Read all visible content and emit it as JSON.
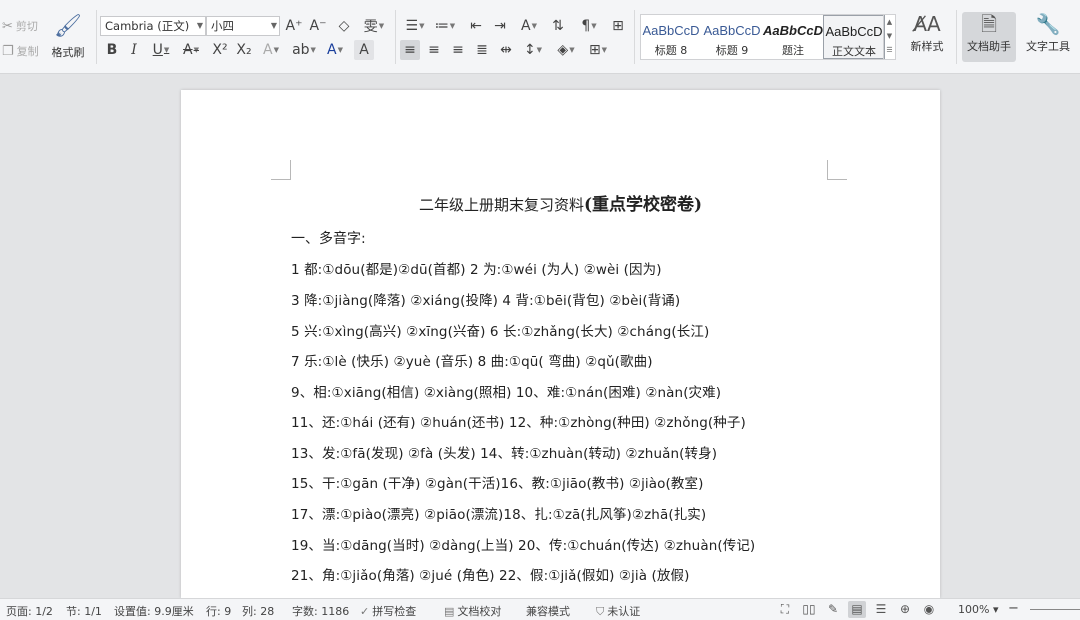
{
  "ribbon": {
    "clipboard": {
      "cut_label": "剪切",
      "copy_label": "复制",
      "format_painter_label": "格式刷"
    },
    "font": {
      "name": "Cambria (正文)",
      "size": "小四"
    },
    "styles": [
      {
        "preview": "AaBbCcD",
        "name": "标题 8"
      },
      {
        "preview": "AaBbCcD",
        "name": "标题 9"
      },
      {
        "preview": "AaBbCcD",
        "name": "题注"
      },
      {
        "preview": "AaBbCcD",
        "name": "正文文本"
      }
    ],
    "new_style_label": "新样式",
    "doc_assistant_label": "文档助手",
    "text_tools_label": "文字工具"
  },
  "document": {
    "title_prefix": "二年级上册期末复习资料",
    "title_highlight": "(重点学校密卷)",
    "section_heading": "一、多音字:",
    "lines": [
      "1 都:①dōu(都是)②dū(首都) 2 为:①wéi (为人) ②wèi (因为)",
      "3 降:①jiàng(降落) ②xiáng(投降) 4 背:①bēi(背包) ②bèi(背诵)",
      "5 兴:①xìng(高兴) ②xīng(兴奋) 6 长:①zhǎng(长大) ②cháng(长江)",
      "7 乐:①lè (快乐) ②yuè (音乐) 8 曲:①qū( 弯曲) ②qǔ(歌曲)",
      "9、相:①xiāng(相信) ②xiàng(照相) 10、难:①nán(困难) ②nàn(灾难)",
      "11、还:①hái (还有) ②huán(还书) 12、种:①zhòng(种田) ②zhǒng(种子)",
      "13、发:①fā(发现) ②fà (头发) 14、转:①zhuàn(转动) ②zhuǎn(转身)",
      "15、干:①gān (干净) ②gàn(干活)16、教:①jiāo(教书) ②jiào(教室)",
      "17、漂:①piào(漂亮) ②piāo(漂流)18、扎:①zā(扎风筝)②zhā(扎实)",
      "19、当:①dāng(当时) ②dàng(上当) 20、传:①chuán(传达) ②zhuàn(传记)",
      "21、角:①jiǎo(角落) ②jué (角色) 22、假:①jiǎ(假如) ②jià (放假)"
    ]
  },
  "status": {
    "page": "页面: 1/2",
    "section": "节: 1/1",
    "setting": "设置值: 9.9厘米",
    "row": "行: 9",
    "col": "列: 28",
    "word_count": "字数: 1186",
    "spell_check": "拼写检查",
    "proofread": "文档校对",
    "compat_mode": "兼容模式",
    "cert": "未认证",
    "zoom": "100%"
  }
}
